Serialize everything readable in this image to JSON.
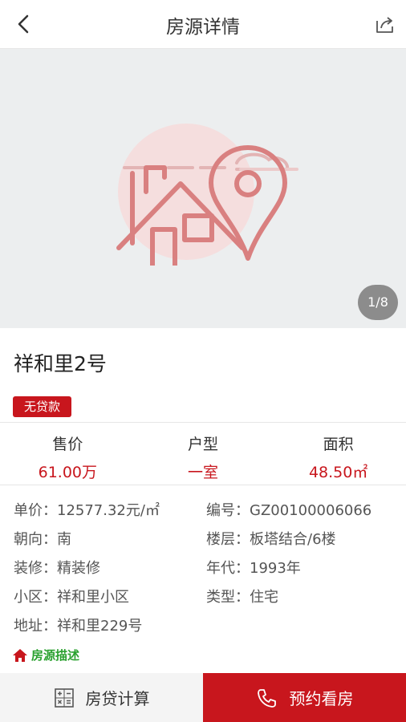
{
  "header": {
    "title": "房源详情",
    "back_icon": "chevron-left-icon",
    "share_icon": "share-icon"
  },
  "gallery": {
    "pager": "1/8",
    "placeholder_icon": "house-location-placeholder",
    "accent_color": "#e09a9a"
  },
  "listing": {
    "name": "祥和里2号",
    "tag": "无贷款"
  },
  "stats": [
    {
      "label": "售价",
      "value": "61.00万"
    },
    {
      "label": "户型",
      "value": "一室"
    },
    {
      "label": "面积",
      "value": "48.50㎡"
    }
  ],
  "details": {
    "unit_price": {
      "key": "单价：",
      "value": "12577.32元/㎡"
    },
    "code": {
      "key": "编号：",
      "value": "GZ00100006066"
    },
    "orientation": {
      "key": "朝向：",
      "value": "南"
    },
    "floor": {
      "key": "楼层：",
      "value": "板塔结合/6楼"
    },
    "decoration": {
      "key": "装修：",
      "value": "精装修"
    },
    "year": {
      "key": "年代：",
      "value": "1993年"
    },
    "community": {
      "key": "小区：",
      "value": "祥和里小区"
    },
    "type": {
      "key": "类型：",
      "value": "住宅"
    },
    "address": {
      "key": "地址：",
      "value": "祥和里229号"
    }
  },
  "description": {
    "title": "房源描述",
    "icon": "home-icon"
  },
  "actions": {
    "calc_label": "房贷计算",
    "calc_icon": "calculator-icon",
    "book_label": "预约看房",
    "book_icon": "phone-icon"
  },
  "colors": {
    "brand": "#c8161d",
    "green": "#2aa12f"
  }
}
